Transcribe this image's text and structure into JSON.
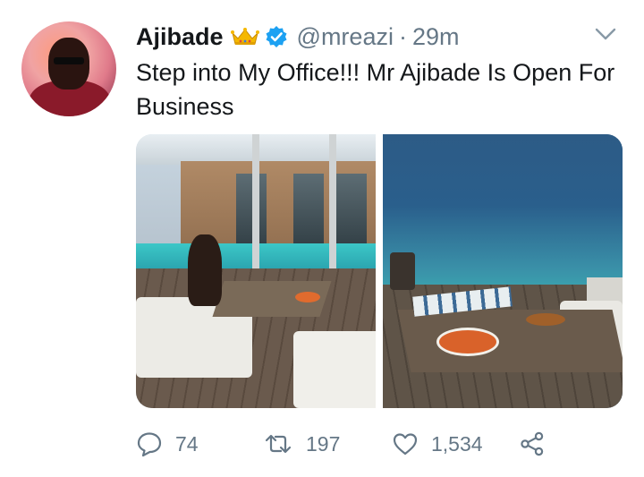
{
  "tweet": {
    "author_name": "Ajibade",
    "handle": "@mreazi",
    "separator": "·",
    "time": "29m",
    "text": "Step into My Office!!! Mr Ajibade Is Open For Business",
    "badges": [
      "crown-emoji",
      "verified-badge-icon"
    ],
    "menu_icon": "chevron-down-icon"
  },
  "media": {
    "count": 2,
    "images": [
      "villa-deck-photo",
      "ocean-table-photo"
    ]
  },
  "actions": {
    "reply_count": "74",
    "retweet_count": "197",
    "like_count": "1,534",
    "icons": [
      "reply-icon",
      "retweet-icon",
      "like-icon",
      "share-icon"
    ]
  },
  "colors": {
    "text": "#14171a",
    "muted": "#657786",
    "verified": "#1da1f2"
  }
}
